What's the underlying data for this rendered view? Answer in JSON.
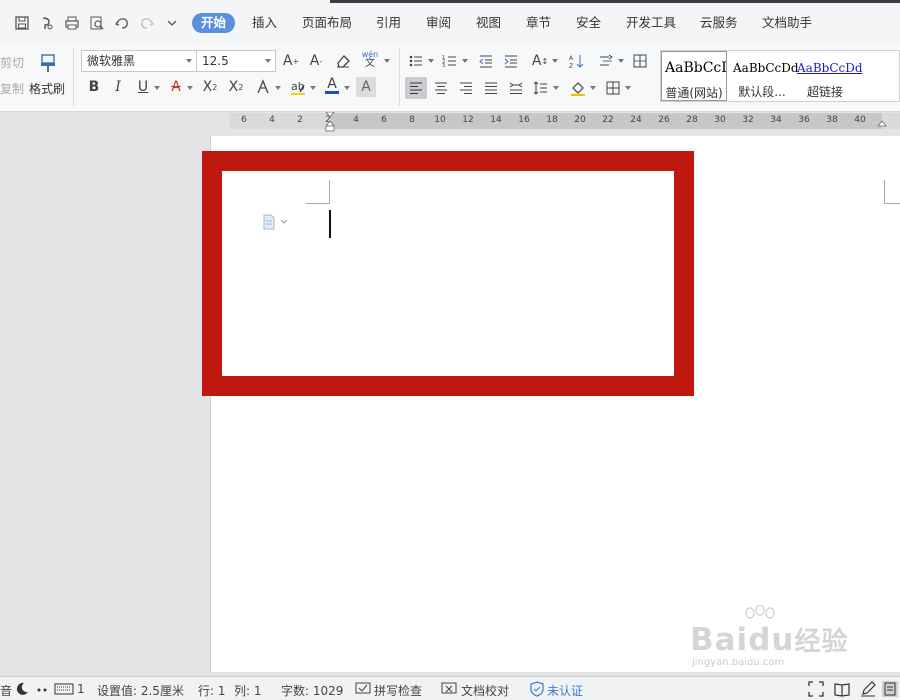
{
  "menu": {
    "tabs": [
      {
        "label": "开始",
        "active": true
      },
      {
        "label": "插入"
      },
      {
        "label": "页面布局"
      },
      {
        "label": "引用"
      },
      {
        "label": "审阅"
      },
      {
        "label": "视图"
      },
      {
        "label": "章节"
      },
      {
        "label": "安全"
      },
      {
        "label": "开发工具"
      },
      {
        "label": "云服务"
      },
      {
        "label": "文档助手"
      }
    ]
  },
  "ribbon": {
    "clipboard": {
      "cut_label": "剪切",
      "copy_label": "复制",
      "format_painter_label": "格式刷"
    },
    "font": {
      "family": "微软雅黑",
      "size": "12.5"
    },
    "styles": [
      {
        "sample": "AaBbCcI",
        "name": "普通(网站)"
      },
      {
        "sample": "AaBbCcDd",
        "name": "默认段..."
      },
      {
        "sample": "AaBbCcDd",
        "name": "超链接"
      }
    ]
  },
  "ruler": {
    "ticks": [
      "6",
      "4",
      "2",
      "2",
      "4",
      "6",
      "8",
      "10",
      "12",
      "14",
      "16",
      "18",
      "20",
      "22",
      "24",
      "26",
      "28",
      "30",
      "32",
      "34",
      "36",
      "38",
      "40"
    ]
  },
  "watermark": {
    "brand": "Bai",
    "brand2": "du",
    "brand_cn": "经验",
    "url": "jingyan.baidu.com"
  },
  "statusbar": {
    "page": "1",
    "setting": "设置值: 2.5厘米",
    "row": "行: 1",
    "col": "列: 1",
    "word_count": "字数: 1029",
    "spellcheck": "拼写检查",
    "doc_proof": "文档校对",
    "auth": "未认证"
  },
  "colors": {
    "active_tab": "#5b8fd9",
    "highlight_frame": "#c0180e",
    "font_color_underline": "#1f4fbf",
    "verify_blue": "#3a7bd5"
  }
}
